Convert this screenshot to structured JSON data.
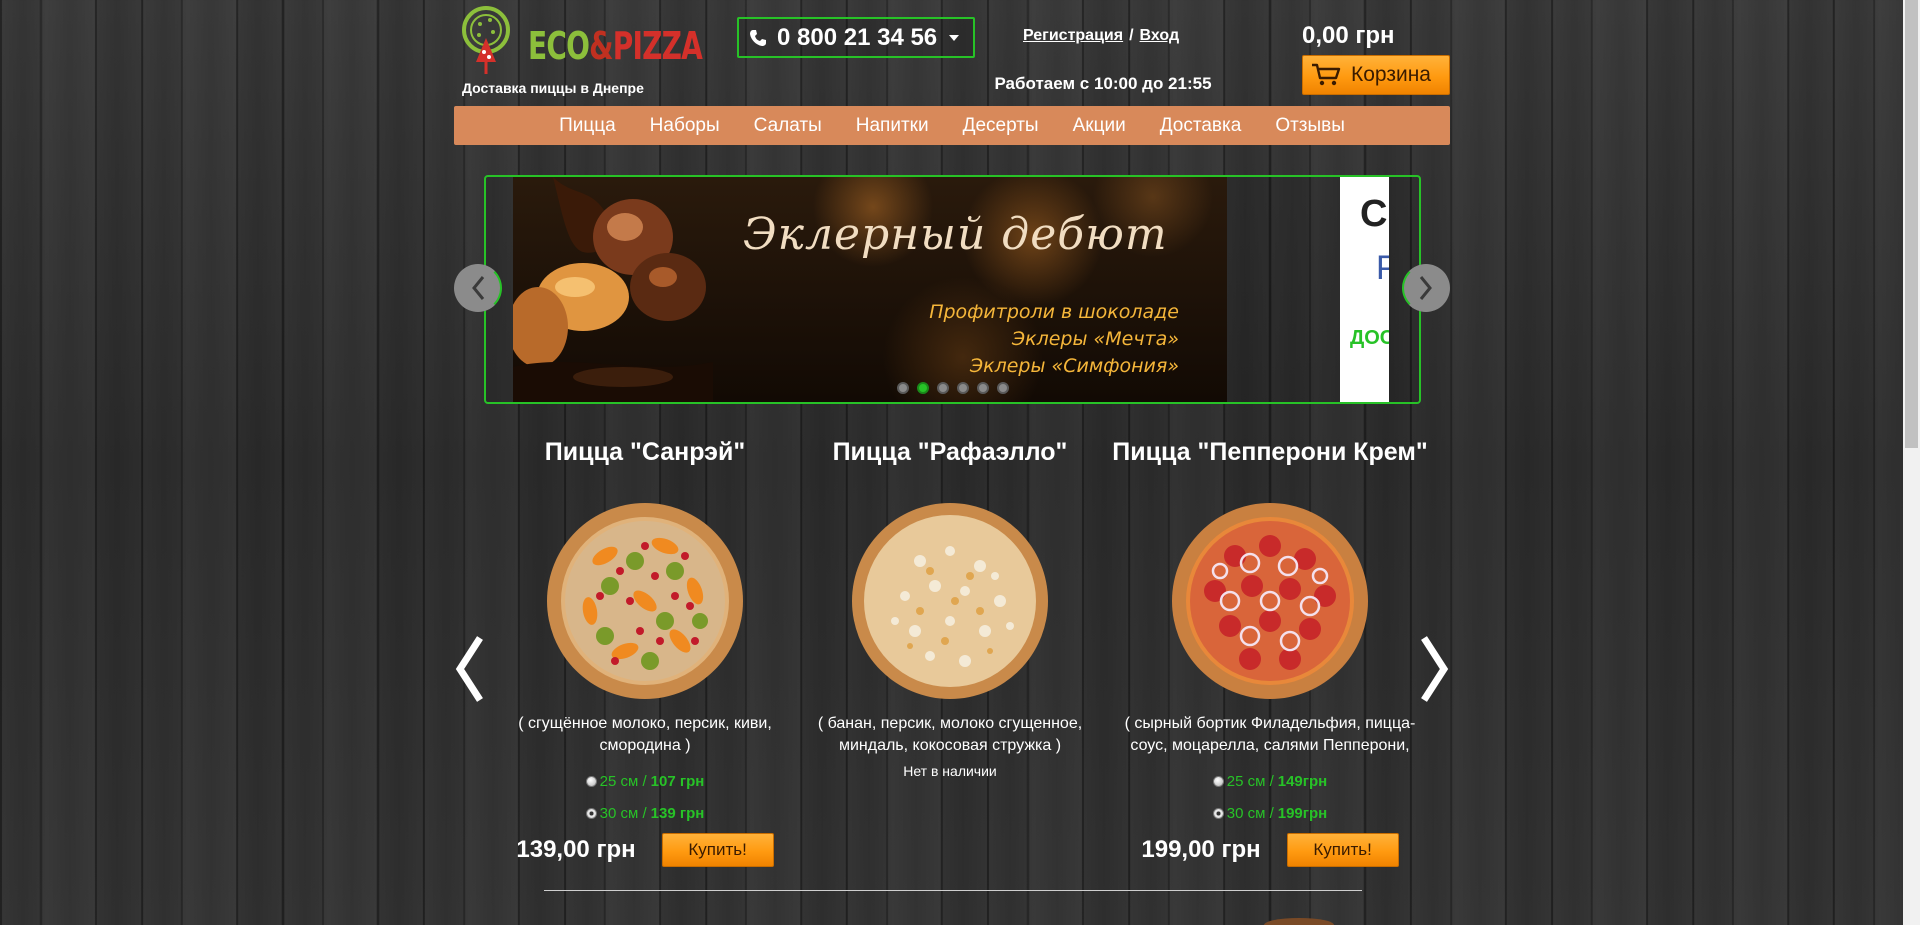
{
  "brand": {
    "logo_eco": "ECO",
    "logo_amp": "&",
    "logo_pizza": "PIZZA",
    "tagline": "Доставка пиццы в Днепре",
    "green": "#27c227",
    "orange": "#ff9a10",
    "nav_color": "#d8895a"
  },
  "header": {
    "phone": "0 800 21 34 56",
    "register": "Регистрация",
    "separator": "/",
    "login": "Вход",
    "hours": "Работаем с 10:00 до 21:55",
    "cart_total": "0,00 грн",
    "cart_label": "Корзина"
  },
  "nav": {
    "items": [
      "Пицца",
      "Наборы",
      "Салаты",
      "Напитки",
      "Десерты",
      "Акции",
      "Доставка",
      "Отзывы"
    ]
  },
  "slider": {
    "title": "Эклерный дебют",
    "lines": [
      "Профитроли в шоколаде",
      "Эклеры «Мечта»",
      "Эклеры «Симфония»"
    ],
    "next_preview": {
      "t1": "СП",
      "t2": "Р",
      "t3": "ДОС"
    },
    "dot_count": 6,
    "active_dot": 1
  },
  "products": [
    {
      "title": "Пицца \"Санрэй\"",
      "description": "( сгущённое молоко, персик, киви, смородина )",
      "in_stock": true,
      "sizes": [
        {
          "size": "25 см /",
          "price": "107 грн",
          "checked": false
        },
        {
          "size": "30 см /",
          "price": "139 грн",
          "checked": true
        }
      ],
      "price": "139,00 грн",
      "buy_label": "Купить!"
    },
    {
      "title": "Пицца \"Рафаэлло\"",
      "description": "( банан, персик,  молоко сгущенное, миндаль, кокосовая стружка )",
      "in_stock": false,
      "stock_text": "Нет в наличии"
    },
    {
      "title": "Пицца \"Пепперони Крем\"",
      "description": "( сырный бортик Филадельфия, пицца-соус, моцарелла, салями Пепперони,",
      "in_stock": true,
      "sizes": [
        {
          "size": "25 см /",
          "price": "149грн",
          "checked": false
        },
        {
          "size": "30 см /",
          "price": "199грн",
          "checked": true
        }
      ],
      "price": "199,00 грн",
      "buy_label": "Купить!"
    }
  ]
}
